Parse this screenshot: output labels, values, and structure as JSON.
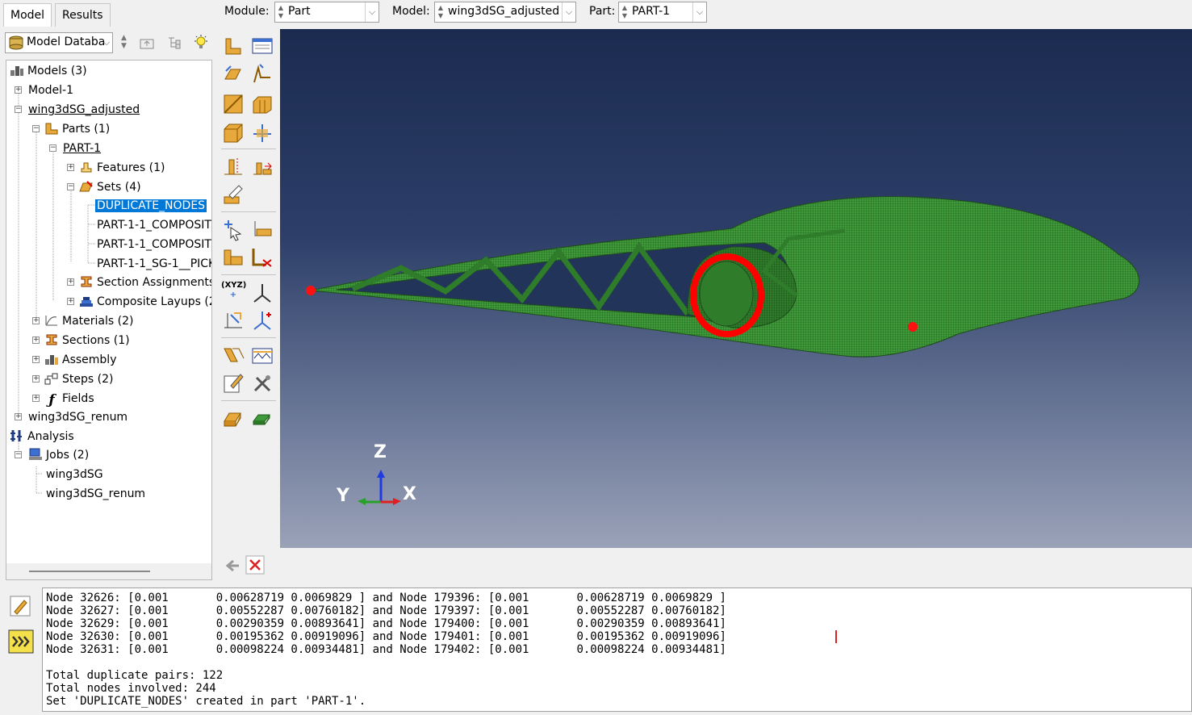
{
  "tabs": {
    "model": "Model",
    "results": "Results"
  },
  "context_bar": {
    "module_label": "Module:",
    "module_value": "Part",
    "model_label": "Model:",
    "model_value": "wing3dSG_adjusted",
    "part_label": "Part:",
    "part_value": "PART-1"
  },
  "tree_toolbar": {
    "combo_value": "Model Databa"
  },
  "tree": {
    "models": "Models (3)",
    "model1": "Model-1",
    "wing_adjusted": "wing3dSG_adjusted",
    "parts": "Parts (1)",
    "part1": "PART-1",
    "features": "Features (1)",
    "sets": "Sets (4)",
    "set_duplicate": "DUPLICATE_NODES",
    "set_composite1": "PART-1-1_COMPOSIT",
    "set_composite2": "PART-1-1_COMPOSIT",
    "set_pick": "PART-1-1_SG-1__PICK",
    "section_assignments": "Section Assignments",
    "composite_layups": "Composite Layups (2",
    "materials": "Materials (2)",
    "sections": "Sections (1)",
    "assembly": "Assembly",
    "steps": "Steps (2)",
    "fields": "Fields",
    "wing_renum": "wing3dSG_renum",
    "analysis": "Analysis",
    "jobs": "Jobs (2)",
    "job1": "wing3dSG",
    "job2": "wing3dSG_renum"
  },
  "triad": {
    "z": "Z",
    "y": "Y",
    "x": "X"
  },
  "colors": {
    "mesh_green": "#3f9b3a",
    "highlight_red": "#ff0000",
    "selection_blue": "#0078d7"
  },
  "messages": [
    "Node 32626: [0.001       0.00628719 0.0069829 ] and Node 179396: [0.001       0.00628719 0.0069829 ]",
    "Node 32627: [0.001       0.00552287 0.00760182] and Node 179397: [0.001       0.00552287 0.00760182]",
    "Node 32629: [0.001       0.00290359 0.00893641] and Node 179400: [0.001       0.00290359 0.00893641]",
    "Node 32630: [0.001       0.00195362 0.00919096] and Node 179401: [0.001       0.00195362 0.00919096]",
    "Node 32631: [0.001       0.00098224 0.00934481] and Node 179402: [0.001       0.00098224 0.00934481]",
    "",
    "Total duplicate pairs: 122",
    "Total nodes involved: 244",
    "Set 'DUPLICATE_NODES' created in part 'PART-1'."
  ]
}
